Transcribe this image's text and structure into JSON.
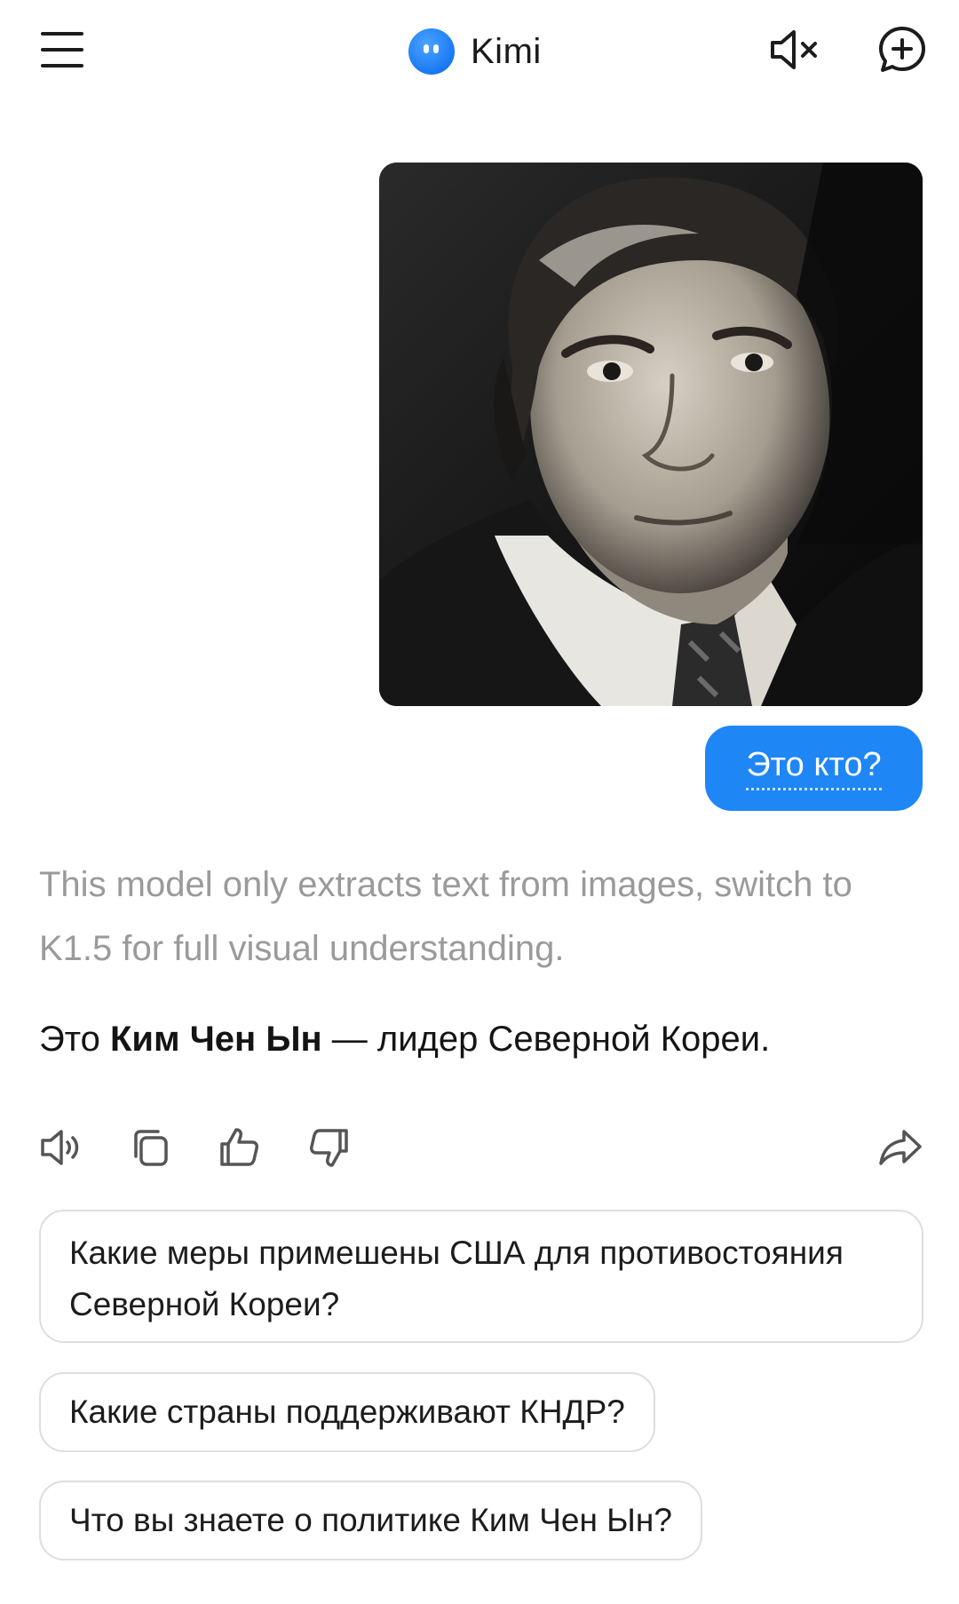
{
  "header": {
    "app_name": "Kimi",
    "brand_color": "#1c7cf4"
  },
  "conversation": {
    "user_message": "Это кто?",
    "user_image": "portrait-photo",
    "model_notice": "This model only extracts text from images, switch to K1.5 for full visual understanding.",
    "answer": {
      "prefix": "Это ",
      "bold": "Ким Чен Ын",
      "suffix": " — лидер Северной Кореи."
    }
  },
  "actions": [
    "speaker-icon",
    "copy-icon",
    "thumbs-up-icon",
    "thumbs-down-icon",
    "share-icon"
  ],
  "suggestions": [
    "Какие меры примешены США для противостояния Северной Кореи?",
    "Какие страны поддерживают КНДР?",
    "Что вы знаете о политике Ким Чен Ын?"
  ],
  "colors": {
    "user_bubble": "#1f86f5",
    "notice_text": "#9a9a9a",
    "suggestion_border": "#dedede"
  }
}
